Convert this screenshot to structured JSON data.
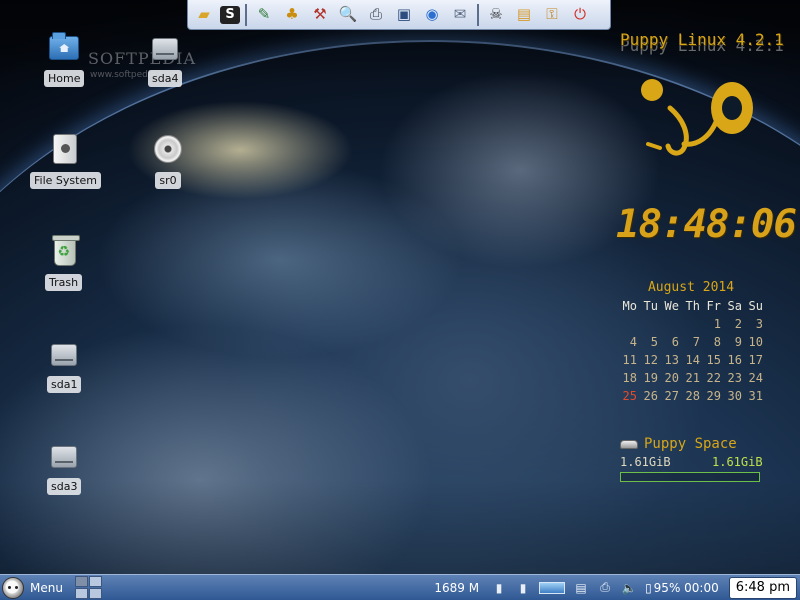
{
  "launcher": {
    "icons": [
      {
        "name": "eraser-icon",
        "glyph": "▰",
        "color": "#d9a62a"
      },
      {
        "name": "console-icon",
        "glyph": "S",
        "color": "#222222"
      },
      {
        "name": "text-editor-icon",
        "glyph": "✎",
        "color": "#2f7a38"
      },
      {
        "name": "pet-installer-icon",
        "glyph": "♣",
        "color": "#c98d0f"
      },
      {
        "name": "toolbox-icon",
        "glyph": "⚒",
        "color": "#b3332b"
      },
      {
        "name": "search-icon",
        "glyph": "🔍",
        "color": "#334a70"
      },
      {
        "name": "printer-icon",
        "glyph": "⎙",
        "color": "#3b4452"
      },
      {
        "name": "camera-icon",
        "glyph": "▣",
        "color": "#2d4d7e"
      },
      {
        "name": "browser-icon",
        "glyph": "◉",
        "color": "#2b6fd1"
      },
      {
        "name": "mail-icon",
        "glyph": "✉",
        "color": "#5b6b86"
      },
      {
        "name": "skull-icon",
        "glyph": "☠",
        "color": "#333333"
      },
      {
        "name": "package-icon",
        "glyph": "▤",
        "color": "#d69a2a"
      },
      {
        "name": "lock-icon",
        "glyph": "⚿",
        "color": "#c2831a"
      },
      {
        "name": "power-icon",
        "glyph": "⏻",
        "color": "#d2302a"
      }
    ]
  },
  "desktop": {
    "icons": {
      "home": {
        "label": "Home",
        "icon": "home-folder-icon"
      },
      "sda4": {
        "label": "sda4",
        "icon": "drive-icon"
      },
      "filesystem": {
        "label": "File System",
        "icon": "filesystem-icon"
      },
      "sr0": {
        "label": "sr0",
        "icon": "cd-icon"
      },
      "trash": {
        "label": "Trash",
        "icon": "trash-icon"
      },
      "sda1": {
        "label": "sda1",
        "icon": "drive-icon"
      },
      "sda3": {
        "label": "sda3",
        "icon": "drive-icon"
      }
    },
    "watermark": "SOFTPEDIA",
    "watermark_sub": "www.softpedia.com"
  },
  "conky": {
    "title": "Puppy Linux 4.2.1",
    "clock": "18:48:06",
    "calendar": {
      "month": "August 2014",
      "weekdays": [
        "Mo",
        "Tu",
        "We",
        "Th",
        "Fr",
        "Sa",
        "Su"
      ],
      "leading_blanks": 4,
      "days": [
        "1",
        "2",
        "3",
        "4",
        "5",
        "6",
        "7",
        "8",
        "9",
        "10",
        "11",
        "12",
        "13",
        "14",
        "15",
        "16",
        "17",
        "18",
        "19",
        "20",
        "21",
        "22",
        "23",
        "24",
        "25",
        "26",
        "27",
        "28",
        "29",
        "30",
        "31"
      ],
      "today": "25"
    },
    "space": {
      "title": "Puppy Space",
      "used": "1.61GiB",
      "free": "1.61GiB"
    },
    "accent_color": "#d8a617"
  },
  "taskbar": {
    "menu_label": "Menu",
    "memory": "1689 M",
    "battery": "95% 00:00",
    "clock": "6:48 pm"
  }
}
